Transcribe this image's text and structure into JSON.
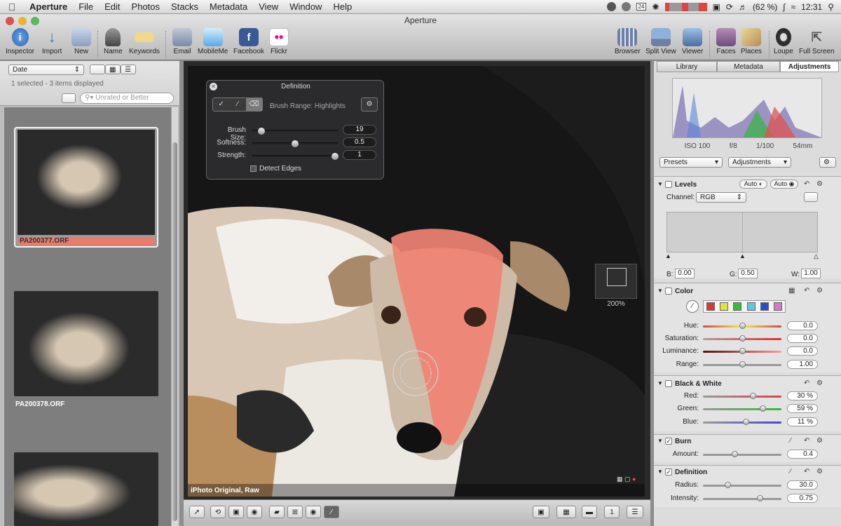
{
  "menubar": {
    "app_name": "Aperture",
    "items": [
      "File",
      "Edit",
      "Photos",
      "Stacks",
      "Metadata",
      "View",
      "Window",
      "Help"
    ],
    "battery": "(62 %)",
    "clock": "12:31",
    "calendar_day": "24"
  },
  "window": {
    "title": "Aperture"
  },
  "toolbar": {
    "left": [
      {
        "label": "Inspector",
        "icon": "info-icon"
      },
      {
        "label": "Import",
        "icon": "import-arrow-icon"
      },
      {
        "label": "New",
        "icon": "new-icon"
      },
      {
        "label": "Name",
        "icon": "name-icon"
      },
      {
        "label": "Keywords",
        "icon": "keywords-tag-icon"
      },
      {
        "label": "Email",
        "icon": "email-icon"
      },
      {
        "label": "MobileMe",
        "icon": "mobileme-icon"
      },
      {
        "label": "Facebook",
        "icon": "facebook-icon"
      },
      {
        "label": "Flickr",
        "icon": "flickr-icon"
      }
    ],
    "right": [
      {
        "label": "Browser",
        "icon": "browser-grid-icon"
      },
      {
        "label": "Split View",
        "icon": "split-view-icon"
      },
      {
        "label": "Viewer",
        "icon": "viewer-icon"
      },
      {
        "label": "Faces",
        "icon": "faces-icon"
      },
      {
        "label": "Places",
        "icon": "places-map-icon"
      },
      {
        "label": "Loupe",
        "icon": "loupe-icon"
      },
      {
        "label": "Full Screen",
        "icon": "full-screen-icon"
      }
    ]
  },
  "browser": {
    "sort_select": "Date",
    "status": "1 selected - 3 items displayed",
    "filter_placeholder": "Unrated or Better",
    "thumbs": [
      {
        "name": "PA200377.ORF",
        "selected": true
      },
      {
        "name": "PA200378.ORF",
        "selected": false
      },
      {
        "name": "",
        "selected": false
      }
    ]
  },
  "hud": {
    "title": "Definition",
    "brush_range": "Brush Range: Highlights",
    "brush_size_label": "Brush Size:",
    "brush_size_value": "19",
    "brush_size_level": 0.08,
    "softness_label": "Softness:",
    "softness_value": "0.5",
    "softness_level": 0.5,
    "strength_label": "Strength:",
    "strength_value": "1",
    "strength_level": 1.0,
    "detect_edges_label": "Detect Edges"
  },
  "viewer": {
    "image_label": "iPhoto Original, Raw",
    "zoom_label": "200%"
  },
  "inspector": {
    "tabs": [
      "Library",
      "Metadata",
      "Adjustments"
    ],
    "active_tab": "Adjustments",
    "exif": {
      "iso": "ISO 100",
      "aperture": "f/8",
      "shutter": "1/100",
      "focal": "54mm"
    },
    "presets_label": "Presets",
    "adjustments_label": "Adjustments",
    "levels": {
      "title": "Levels",
      "auto1": "Auto",
      "auto2": "Auto",
      "channel_label": "Channel:",
      "channel_value": "RGB",
      "b_label": "B:",
      "b_value": "0.00",
      "g_label": "G:",
      "g_value": "0.50",
      "w_label": "W:",
      "w_value": "1.00"
    },
    "color": {
      "title": "Color",
      "swatches": [
        "#d63a2d",
        "#e6e03a",
        "#3db83d",
        "#62c6e0",
        "#2d4ccc",
        "#d27bc9"
      ],
      "rows": [
        {
          "label": "Hue:",
          "value": "0.0",
          "level": 0.5
        },
        {
          "label": "Saturation:",
          "value": "0.0",
          "level": 0.5
        },
        {
          "label": "Luminance:",
          "value": "0.0",
          "level": 0.5
        },
        {
          "label": "Range:",
          "value": "1.00",
          "level": 0.5
        }
      ]
    },
    "bw": {
      "title": "Black & White",
      "rows": [
        {
          "label": "Red:",
          "value": "30 %",
          "level": 0.65
        },
        {
          "label": "Green:",
          "value": "59 %",
          "level": 0.79
        },
        {
          "label": "Blue:",
          "value": "11 %",
          "level": 0.55
        }
      ]
    },
    "burn": {
      "title": "Burn",
      "checked": true,
      "amount_label": "Amount:",
      "amount_value": "0.4",
      "level": 0.4
    },
    "definition": {
      "title": "Definition",
      "checked": true,
      "radius_label": "Radius:",
      "radius_value": "30.0",
      "radius_level": 0.3,
      "intensity_label": "Intensity:",
      "intensity_value": "0.75",
      "intensity_level": 0.75
    }
  }
}
